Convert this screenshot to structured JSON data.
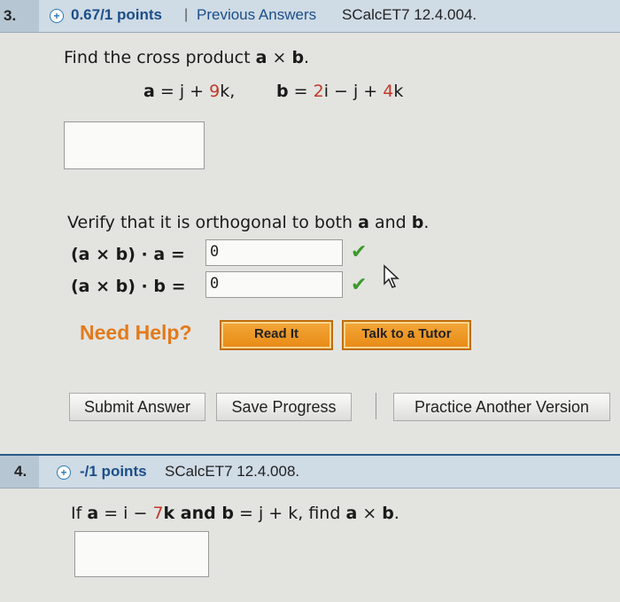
{
  "q3": {
    "number": "3.",
    "points": "0.67/1 points",
    "separator": "|",
    "previous_answers": "Previous Answers",
    "code": "SCalcET7 12.4.004.",
    "prompt_pre": "Find the cross product ",
    "prompt_a": "a",
    "prompt_times": " × ",
    "prompt_b": "b",
    "prompt_end": ".",
    "eq_a_lhs": "a",
    "eq_a_rhs": " = j + ",
    "eq_a_coef": "9",
    "eq_a_end": "k,",
    "eq_b_lhs": "b",
    "eq_b_rhs": " = ",
    "eq_b_c1": "2",
    "eq_b_mid": "i − j + ",
    "eq_b_c2": "4",
    "eq_b_end": "k",
    "verify_pre": "Verify that it is orthogonal to both ",
    "verify_a": "a",
    "verify_and": " and ",
    "verify_b": "b",
    "verify_end": ".",
    "dot_a_expr": "(a × b) · a  =",
    "dot_a_value": "0",
    "dot_b_expr": "(a × b) · b  =",
    "dot_b_value": "0",
    "need_help": "Need Help?",
    "read_it": "Read It",
    "talk_tutor": "Talk to a Tutor",
    "submit": "Submit Answer",
    "save": "Save Progress",
    "practice": "Practice Another Version"
  },
  "q4": {
    "number": "4.",
    "points": "-/1 points",
    "code": "SCalcET7 12.4.008.",
    "prompt_if": "If ",
    "prompt_a": "a",
    "prompt_a_rhs": " = i − ",
    "prompt_coef": "7",
    "prompt_k": "k and ",
    "prompt_b": "b",
    "prompt_b_rhs": " = j + k, find ",
    "prompt_a2": "a",
    "prompt_times": " × ",
    "prompt_b2": "b",
    "prompt_end": "."
  },
  "colors": {
    "accent": "#1b4e88",
    "coef_red": "#c0392b",
    "help_orange": "#e27a1c",
    "check_green": "#3c9a2c"
  }
}
